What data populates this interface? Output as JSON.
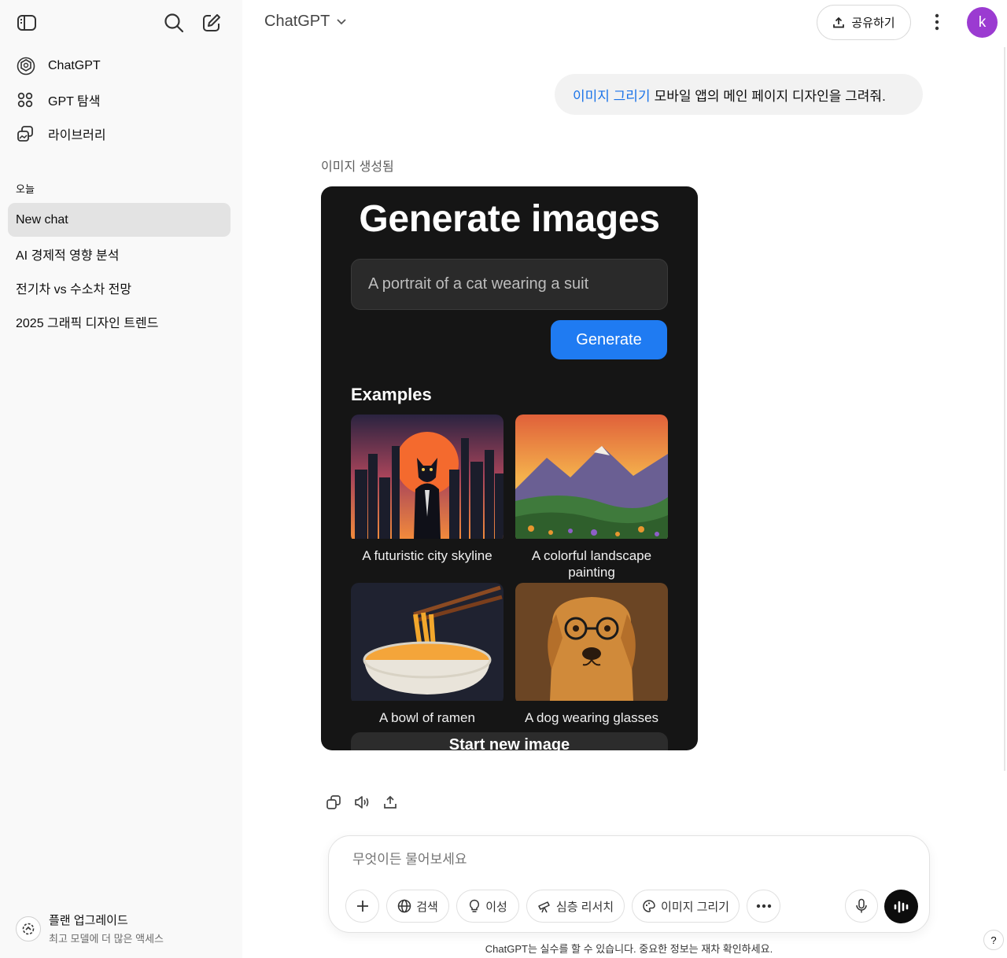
{
  "sidebar": {
    "nav": [
      {
        "label": "ChatGPT",
        "icon": "openai-logo-icon"
      },
      {
        "label": "GPT 탐색",
        "icon": "grid-icon"
      },
      {
        "label": "라이브러리",
        "icon": "library-icon"
      }
    ],
    "section_today": "오늘",
    "chats": [
      "New chat",
      "AI 경제적 영향 분석",
      "전기차 vs 수소차 전망",
      "2025 그래픽 디자인 트렌드"
    ],
    "upgrade": {
      "title": "플랜 업그레이드",
      "subtitle": "최고 모델에 더 많은 액세스"
    }
  },
  "header": {
    "model": "ChatGPT",
    "share_label": "공유하기",
    "avatar_initial": "k",
    "avatar_color": "#9b3bd1"
  },
  "conversation": {
    "user_tag": "이미지 그리기",
    "user_text": "모바일 앱의 메인 페이지 디자인을 그려줘.",
    "image_status": "이미지 생성됨",
    "image": {
      "title": "Generate images",
      "input_text": "A portrait of a cat wearing a suit",
      "generate_label": "Generate",
      "examples_heading": "Examples",
      "examples": [
        {
          "caption": "A futuristic city skyline"
        },
        {
          "caption": "A colorful landscape painting"
        },
        {
          "caption": "A bowl of ramen"
        },
        {
          "caption": "A dog wearing glasses"
        }
      ],
      "start_label": "Start new image",
      "accent": "#1f7bf2"
    }
  },
  "composer": {
    "placeholder": "무엇이든 물어보세요",
    "buttons": {
      "search": "검색",
      "reason": "이성",
      "deep_research": "심층 리서치",
      "image": "이미지 그리기"
    }
  },
  "disclaimer": "ChatGPT는 실수를 할 수 있습니다. 중요한 정보는 재차 확인하세요.",
  "help": "?"
}
